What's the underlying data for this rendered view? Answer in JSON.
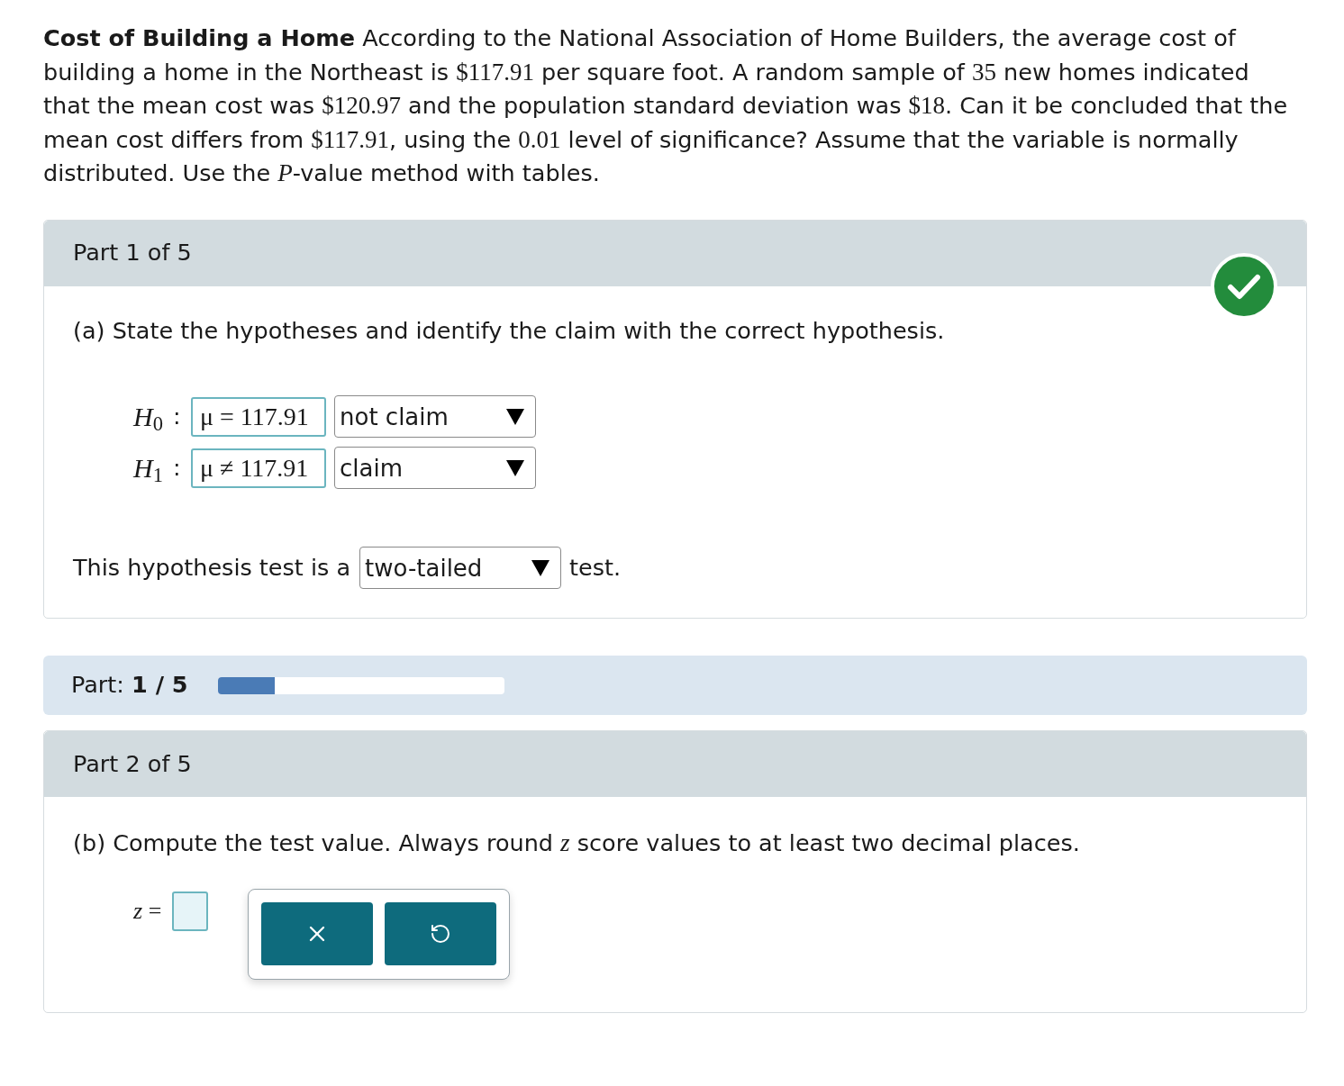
{
  "problem": {
    "segments": [
      {
        "kind": "bold",
        "text": "Cost of Building a Home"
      },
      {
        "kind": "text",
        "text": " According to the National Association of Home Builders, the average cost of building a home in the Northeast is "
      },
      {
        "kind": "math",
        "text": "$117.91"
      },
      {
        "kind": "text",
        "text": " per square foot. A random sample of "
      },
      {
        "kind": "math",
        "text": "35"
      },
      {
        "kind": "text",
        "text": " new homes indicated that the mean cost was "
      },
      {
        "kind": "math",
        "text": "$120.97"
      },
      {
        "kind": "text",
        "text": " and the population standard deviation was "
      },
      {
        "kind": "math",
        "text": "$18"
      },
      {
        "kind": "text",
        "text": ". Can it be concluded that the mean cost differs from "
      },
      {
        "kind": "math",
        "text": "$117.91"
      },
      {
        "kind": "text",
        "text": ", using the "
      },
      {
        "kind": "math",
        "text": "0.01"
      },
      {
        "kind": "text",
        "text": " level of significance? Assume that the variable is normally distributed. Use the "
      },
      {
        "kind": "math",
        "text": "*P*"
      },
      {
        "kind": "text",
        "text": "-value method with tables."
      }
    ]
  },
  "part_1": {
    "title": "Part 1 of 5",
    "complete": true,
    "prompt": [
      {
        "kind": "text",
        "text": "(a) State the hypotheses and identify the claim with the correct hypothesis."
      }
    ],
    "hypotheses": [
      {
        "label": "*H*$_{0}$",
        "separator": ":",
        "expression": "μ = 117.91",
        "choice": "not claim"
      },
      {
        "label": "*H*$_{1}$",
        "separator": ":",
        "expression": "μ ≠ 117.91",
        "choice": "claim"
      }
    ],
    "test_type": {
      "before": "This hypothesis test is a",
      "choice": "two-tailed",
      "after": "test."
    }
  },
  "progress": {
    "label": "Part: **1 / 5**",
    "level": 0.2
  },
  "part_2": {
    "title": "Part 2 of 5",
    "complete": false,
    "prompt": [
      {
        "kind": "text",
        "text": "(b) Compute the test value. Always round "
      },
      {
        "kind": "math",
        "text": "*z*"
      },
      {
        "kind": "text",
        "text": " score values to at least two decimal places."
      }
    ],
    "answer": {
      "label": "*z* ="
    }
  }
}
